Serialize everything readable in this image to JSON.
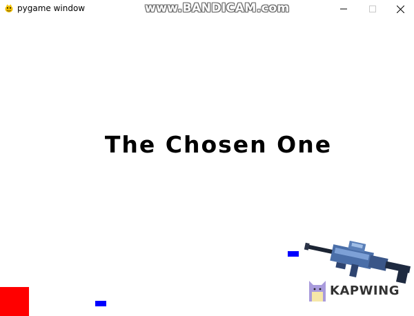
{
  "window": {
    "title": "pygame window",
    "watermark": "www.BANDICAM.com"
  },
  "game": {
    "title_text": "The Chosen One",
    "player_color": "#ff0000",
    "bullet_color": "#0000ff"
  },
  "overlay": {
    "brand": "KAPWING"
  }
}
